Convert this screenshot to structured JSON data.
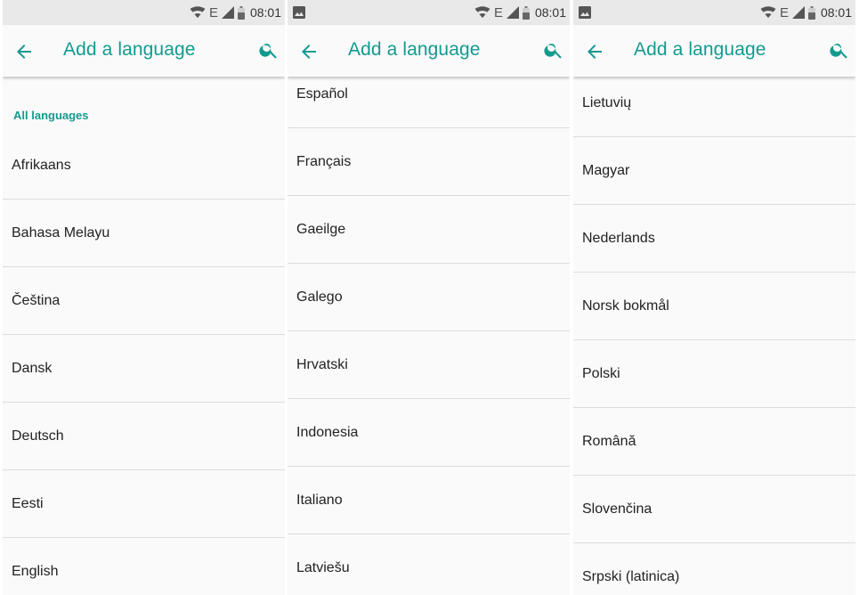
{
  "status": {
    "network": "E",
    "time": "08:01"
  },
  "appbar": {
    "title": "Add a language"
  },
  "screens": [
    {
      "section_header": "All languages",
      "items": [
        "Afrikaans",
        "Bahasa Melayu",
        "Čeština",
        "Dansk",
        "Deutsch",
        "Eesti",
        "English"
      ]
    },
    {
      "items": [
        "Español",
        "Français",
        "Gaeilge",
        "Galego",
        "Hrvatski",
        "Indonesia",
        "Italiano",
        "Latviešu"
      ]
    },
    {
      "items": [
        "Lietuvių",
        "Magyar",
        "Nederlands",
        "Norsk bokmål",
        "Polski",
        "Română",
        "Slovenčina",
        "Srpski (latinica)"
      ]
    }
  ]
}
